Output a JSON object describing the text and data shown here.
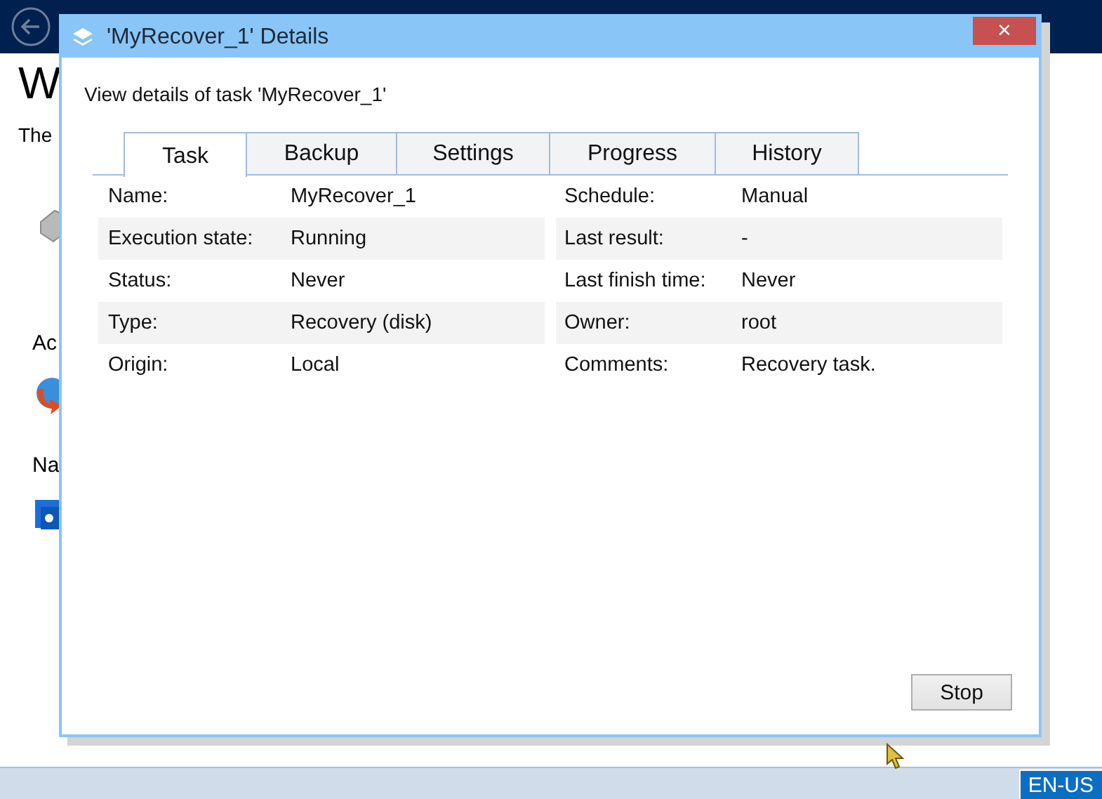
{
  "background": {
    "heading": "W",
    "intro": "The",
    "section_1": "Ac",
    "section_2": "Na",
    "language": "EN-US"
  },
  "dialog": {
    "title": "'MyRecover_1' Details",
    "close": "×",
    "description": "View details of task 'MyRecover_1'",
    "tabs": [
      {
        "label": "Task",
        "selected": true
      },
      {
        "label": "Backup",
        "selected": false
      },
      {
        "label": "Settings",
        "selected": false
      },
      {
        "label": "Progress",
        "selected": false
      },
      {
        "label": "History",
        "selected": false
      }
    ],
    "details": [
      {
        "left": {
          "label": "Name:",
          "value": "MyRecover_1"
        },
        "right": {
          "label": "Schedule:",
          "value": "Manual"
        }
      },
      {
        "left": {
          "label": "Execution state:",
          "value": "Running"
        },
        "right": {
          "label": "Last result:",
          "value": "-"
        }
      },
      {
        "left": {
          "label": "Status:",
          "value": "Never"
        },
        "right": {
          "label": "Last finish time:",
          "value": "Never"
        }
      },
      {
        "left": {
          "label": "Type:",
          "value": "Recovery (disk)"
        },
        "right": {
          "label": "Owner:",
          "value": "root"
        }
      },
      {
        "left": {
          "label": "Origin:",
          "value": "Local"
        },
        "right": {
          "label": "Comments:",
          "value": "Recovery task."
        }
      }
    ],
    "buttons": [
      "Stop"
    ]
  }
}
